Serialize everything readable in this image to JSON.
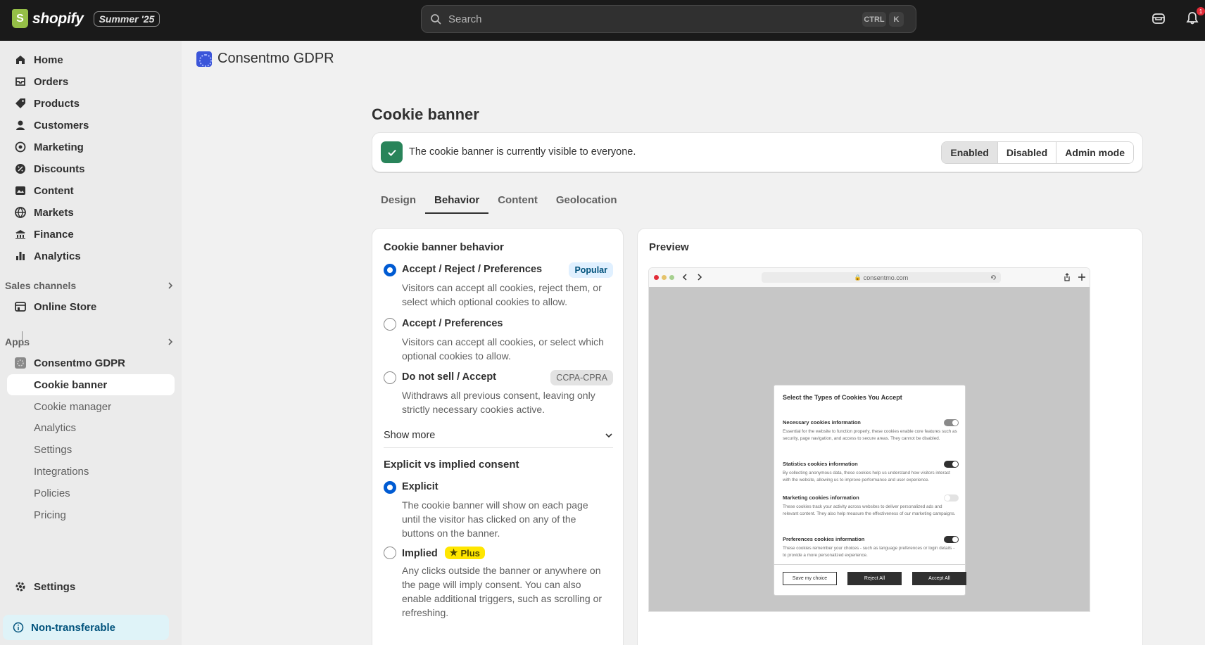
{
  "topbar": {
    "brand": "shopify",
    "edition": "Summer '25",
    "search_placeholder": "Search",
    "shortcut_ctrl": "CTRL",
    "shortcut_key": "K",
    "notification_count": "1"
  },
  "sidebar": {
    "items": [
      {
        "label": "Home",
        "icon": "home-icon"
      },
      {
        "label": "Orders",
        "icon": "orders-icon"
      },
      {
        "label": "Products",
        "icon": "tag-icon"
      },
      {
        "label": "Customers",
        "icon": "person-icon"
      },
      {
        "label": "Marketing",
        "icon": "target-icon"
      },
      {
        "label": "Discounts",
        "icon": "discount-icon"
      },
      {
        "label": "Content",
        "icon": "content-icon"
      },
      {
        "label": "Markets",
        "icon": "globe-icon"
      },
      {
        "label": "Finance",
        "icon": "bank-icon"
      },
      {
        "label": "Analytics",
        "icon": "chart-icon"
      }
    ],
    "sales_channels_label": "Sales channels",
    "online_store": "Online Store",
    "apps_label": "Apps",
    "app_name": "Consentmo GDPR",
    "app_subitems": [
      "Cookie banner",
      "Cookie manager",
      "Analytics",
      "Settings",
      "Integrations",
      "Policies",
      "Pricing"
    ],
    "settings": "Settings",
    "non_transferable": "Non-transferable"
  },
  "app_header": {
    "title": "Consentmo GDPR"
  },
  "page": {
    "title": "Cookie banner",
    "status_text": "The cookie banner is currently visible to everyone.",
    "segments": [
      "Enabled",
      "Disabled",
      "Admin mode"
    ],
    "selected_segment": "Enabled",
    "tabs": [
      "Design",
      "Behavior",
      "Content",
      "Geolocation"
    ],
    "active_tab": "Behavior"
  },
  "behavior": {
    "title": "Cookie banner behavior",
    "options": [
      {
        "label": "Accept / Reject / Preferences",
        "badge": "Popular",
        "desc": "Visitors can accept all cookies, reject them, or select which optional cookies to allow.",
        "selected": true
      },
      {
        "label": "Accept / Preferences",
        "badge": "",
        "desc": "Visitors can accept all cookies, or select which optional cookies to allow.",
        "selected": false
      },
      {
        "label": "Do not sell / Accept",
        "badge": "CCPA-CPRA",
        "desc": "Withdraws all previous consent, leaving only strictly necessary cookies active.",
        "selected": false
      }
    ],
    "show_more": "Show more",
    "consent_title": "Explicit vs implied consent",
    "consent_options": [
      {
        "label": "Explicit",
        "desc": "The cookie banner will show on each page until the visitor has clicked on any of the buttons on the banner.",
        "selected": true
      },
      {
        "label": "Implied",
        "badge": "Plus",
        "desc": "Any clicks outside the banner or anywhere on the page will imply consent. You can also enable additional triggers, such as scrolling or refreshing.",
        "selected": false
      }
    ]
  },
  "preview": {
    "title": "Preview",
    "url": "consentmo.com",
    "modal_title": "Select the Types of Cookies You Accept",
    "sections": [
      {
        "head": "Necessary cookies information",
        "desc": "Essential for the website to function properly, these cookies enable core features such as security, page navigation, and access to secure areas. They cannot be disabled.",
        "toggle": "locked"
      },
      {
        "head": "Statistics cookies information",
        "desc": "By collecting anonymous data, these cookies help us understand how visitors interact with the website, allowing us to improve performance and user experience.",
        "toggle": "on"
      },
      {
        "head": "Marketing cookies information",
        "desc": "These cookies track your activity across websites to deliver personalized ads and relevant content. They also help measure the effectiveness of our marketing campaigns.",
        "toggle": "off"
      },
      {
        "head": "Preferences cookies information",
        "desc": "These cookies remember your choices - such as language preferences or login details - to provide a more personalized experience.",
        "toggle": "on"
      }
    ],
    "buttons": [
      "Save my choice",
      "Reject All",
      "Accept All"
    ]
  },
  "colors": {
    "accent": "#005bd3",
    "success": "#29845a",
    "topbar": "#1a1a1a"
  }
}
